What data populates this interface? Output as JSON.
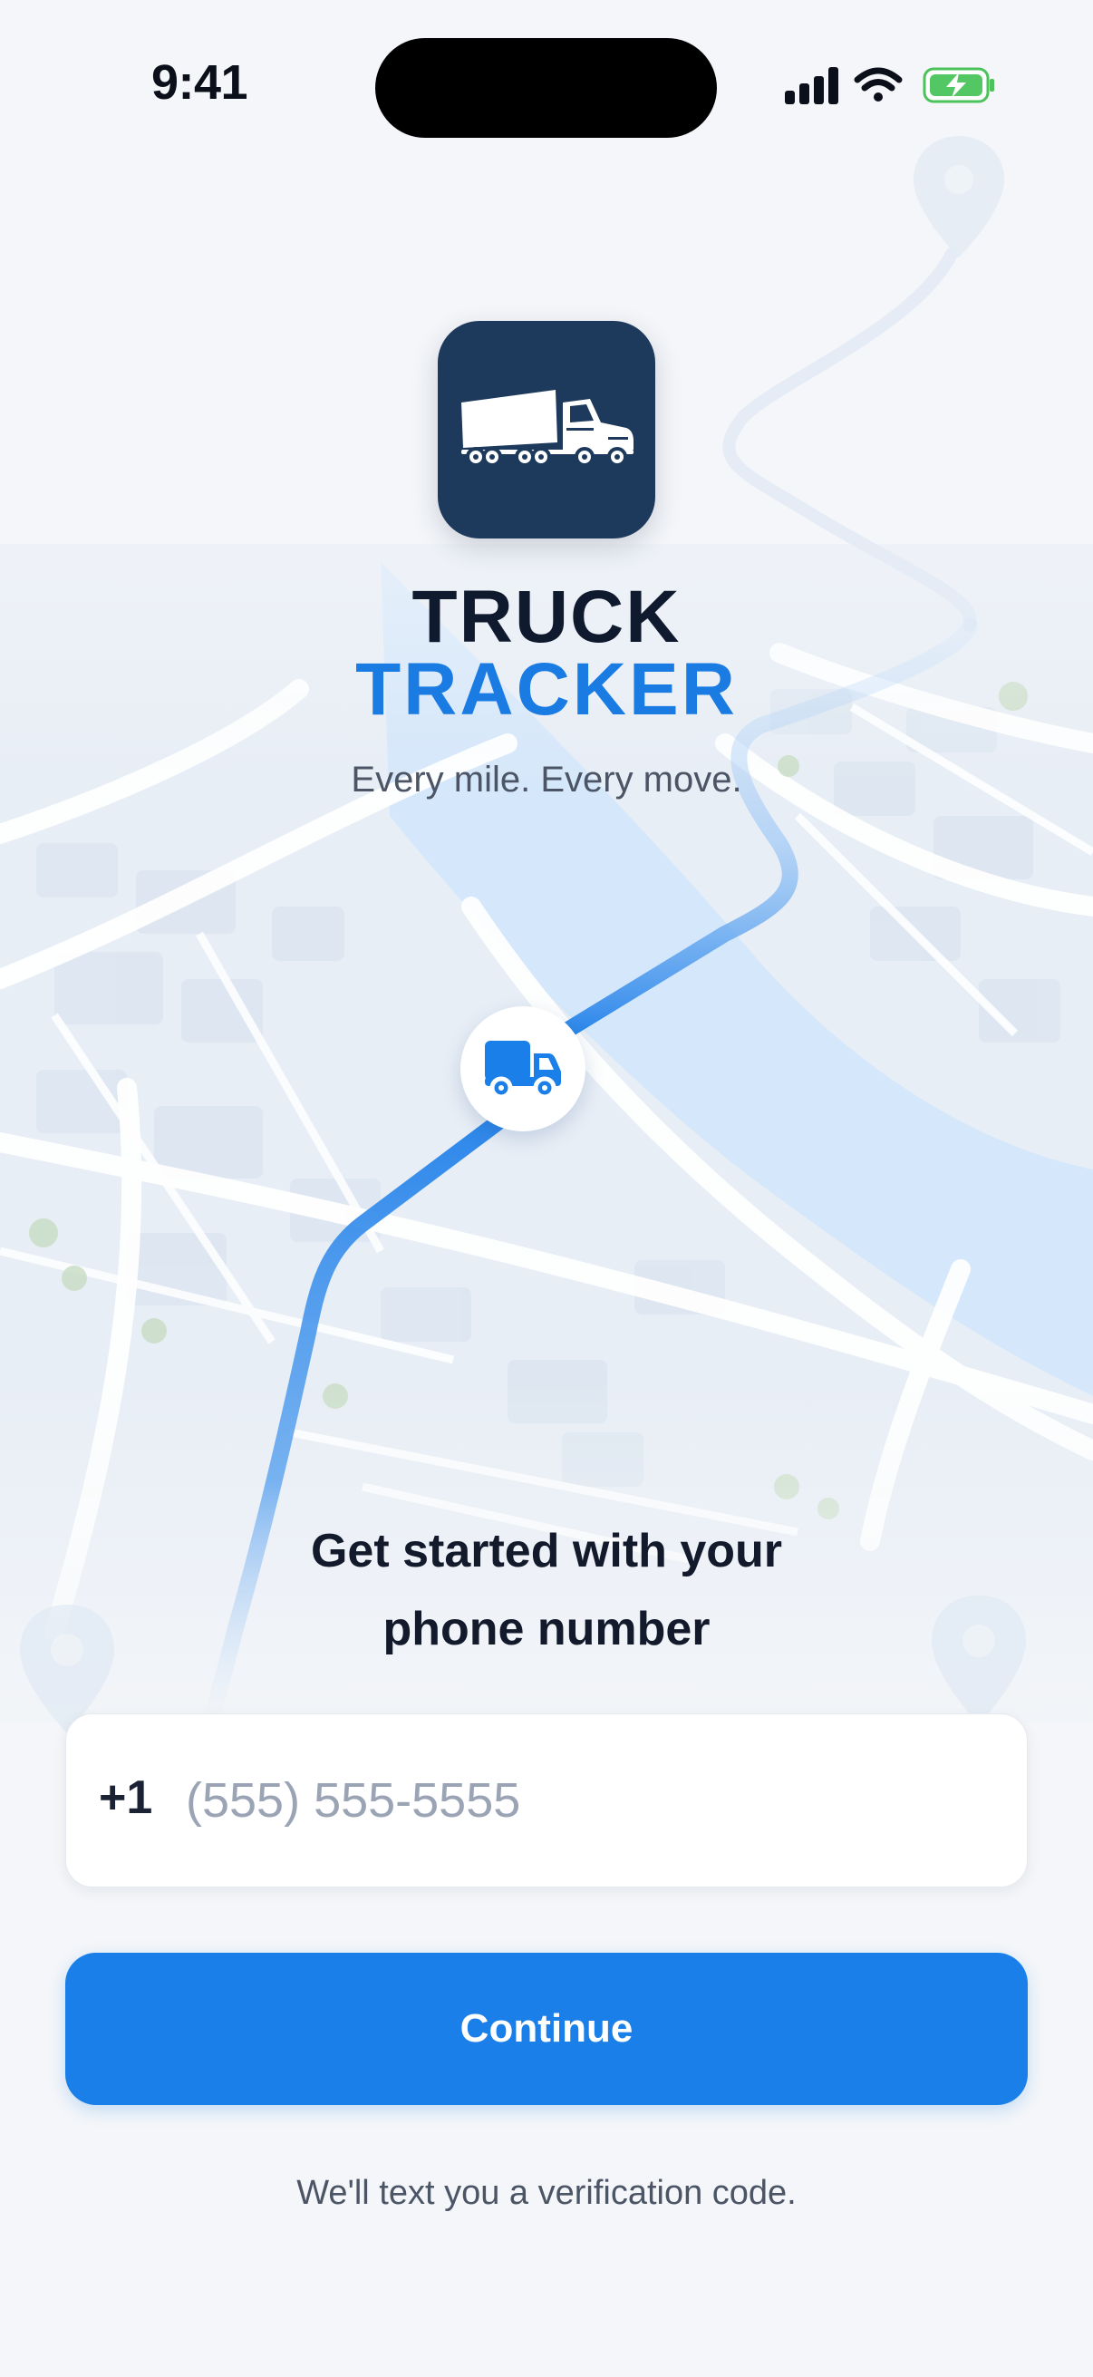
{
  "status_bar": {
    "time": "9:41"
  },
  "brand": {
    "line1": "TRUCK",
    "line2": "TRACKER",
    "tagline": "Every mile. Every move.",
    "icon": "semi-truck-icon"
  },
  "map": {
    "marker_icon": "delivery-truck-icon"
  },
  "form": {
    "heading_line1": "Get started with your",
    "heading_line2": "phone number",
    "country_code": "+1",
    "phone_placeholder": "(555) 555-5555",
    "phone_value": "",
    "continue_label": "Continue",
    "footnote": "We'll text you a verification code."
  },
  "colors": {
    "accent": "#1a7fe8",
    "brand_dark": "#1d3a5c",
    "background": "#f4f6f9"
  }
}
